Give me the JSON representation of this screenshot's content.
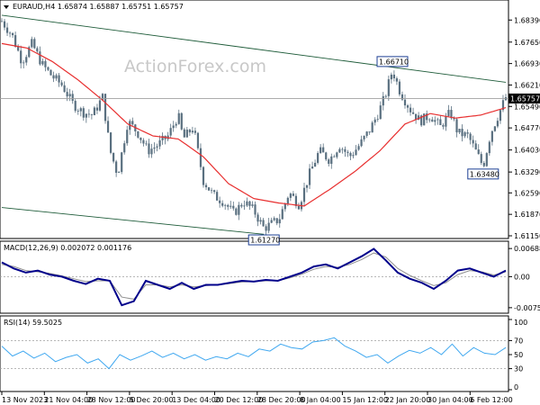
{
  "watermark": "ActionForex.com",
  "price_panel": {
    "title": "EURAUD,H4  1.65874 1.65887 1.65751 1.65757",
    "current_price_label": "1.65757"
  },
  "macd_panel": {
    "title": "MACD(12,26,9) 0.002072 0.001176"
  },
  "rsi_panel": {
    "title": "RSI(14) 59.5025"
  },
  "colors": {
    "candle": "#5a7080",
    "ma": "#e83030",
    "trendline": "#1f5c3a",
    "macd": "#00008b",
    "signal": "#909090",
    "rsi": "#40a8f0",
    "level": "#a0a0a0",
    "box": "#1c3f94",
    "grid": "#d8d8d8"
  },
  "chart_data": [
    {
      "type": "candlestick",
      "name": "EURAUD H4",
      "ylim": [
        1.6115,
        1.687
      ],
      "y_ticks": [
        "1.68390",
        "1.67650",
        "1.66930",
        "1.66210",
        "1.65490",
        "1.64770",
        "1.64030",
        "1.63290",
        "1.62590",
        "1.61870",
        "1.61150"
      ],
      "x_ticks": [
        "13 Nov 2023",
        "21 Nov 04:00",
        "28 Nov 12:00",
        "5 Dec 20:00",
        "13 Dec 04:00",
        "20 Dec 12:00",
        "28 Dec 20:00",
        "8 Jan 04:00",
        "15 Jan 12:00",
        "22 Jan 20:00",
        "30 Jan 04:00",
        "6 Feb 12:00"
      ],
      "close_path": [
        [
          0,
          1.6835
        ],
        [
          0.02,
          1.679
        ],
        [
          0.04,
          1.67
        ],
        [
          0.06,
          1.676
        ],
        [
          0.08,
          1.669
        ],
        [
          0.1,
          1.665
        ],
        [
          0.12,
          1.662
        ],
        [
          0.14,
          1.656
        ],
        [
          0.16,
          1.653
        ],
        [
          0.18,
          1.652
        ],
        [
          0.2,
          1.658
        ],
        [
          0.215,
          1.64
        ],
        [
          0.23,
          1.632
        ],
        [
          0.25,
          1.65
        ],
        [
          0.27,
          1.646
        ],
        [
          0.29,
          1.64
        ],
        [
          0.31,
          1.642
        ],
        [
          0.33,
          1.645
        ],
        [
          0.35,
          1.652
        ],
        [
          0.36,
          1.644
        ],
        [
          0.38,
          1.648
        ],
        [
          0.4,
          1.63
        ],
        [
          0.42,
          1.625
        ],
        [
          0.44,
          1.623
        ],
        [
          0.46,
          1.619
        ],
        [
          0.48,
          1.623
        ],
        [
          0.5,
          1.62
        ],
        [
          0.52,
          1.614
        ],
        [
          0.55,
          1.617
        ],
        [
          0.57,
          1.626
        ],
        [
          0.59,
          1.622
        ],
        [
          0.61,
          1.632
        ],
        [
          0.63,
          1.64
        ],
        [
          0.65,
          1.637
        ],
        [
          0.67,
          1.642
        ],
        [
          0.69,
          1.638
        ],
        [
          0.71,
          1.642
        ],
        [
          0.73,
          1.647
        ],
        [
          0.745,
          1.652
        ],
        [
          0.76,
          1.658
        ],
        [
          0.775,
          1.6671
        ],
        [
          0.79,
          1.66
        ],
        [
          0.81,
          1.654
        ],
        [
          0.83,
          1.65
        ],
        [
          0.85,
          1.652
        ],
        [
          0.87,
          1.648
        ],
        [
          0.89,
          1.653
        ],
        [
          0.905,
          1.646
        ],
        [
          0.925,
          1.645
        ],
        [
          0.94,
          1.64
        ],
        [
          0.955,
          1.6348
        ],
        [
          0.97,
          1.646
        ],
        [
          0.985,
          1.652
        ],
        [
          1.0,
          1.658
        ]
      ],
      "ma_path": [
        [
          0,
          1.676
        ],
        [
          0.05,
          1.6745
        ],
        [
          0.1,
          1.67
        ],
        [
          0.15,
          1.664
        ],
        [
          0.2,
          1.657
        ],
        [
          0.25,
          1.649
        ],
        [
          0.3,
          1.645
        ],
        [
          0.35,
          1.644
        ],
        [
          0.4,
          1.638
        ],
        [
          0.45,
          1.629
        ],
        [
          0.5,
          1.624
        ],
        [
          0.55,
          1.6225
        ],
        [
          0.6,
          1.6215
        ],
        [
          0.65,
          1.627
        ],
        [
          0.7,
          1.633
        ],
        [
          0.75,
          1.64
        ],
        [
          0.8,
          1.649
        ],
        [
          0.85,
          1.6525
        ],
        [
          0.9,
          1.651
        ],
        [
          0.95,
          1.652
        ],
        [
          1.0,
          1.6545
        ]
      ],
      "trendlines": [
        [
          [
            0,
            1.6855
          ],
          [
            1.0,
            1.663
          ]
        ],
        [
          [
            0,
            1.621
          ],
          [
            0.52,
            1.612
          ]
        ]
      ],
      "annotations": [
        {
          "label": "1.66710",
          "x": 0.775,
          "y": 1.6671
        },
        {
          "label": "1.63480",
          "x": 0.955,
          "y": 1.6348
        },
        {
          "label": "1.61270",
          "x": 0.52,
          "y": 1.6127
        }
      ]
    },
    {
      "type": "line",
      "name": "MACD(12,26,9)",
      "ylim": [
        -0.0085,
        0.0078
      ],
      "y_ticks": [
        "0.006886",
        "0.00",
        "-0.007591"
      ],
      "series": [
        {
          "name": "MACD",
          "values": [
            0.0035,
            0.002,
            0.001,
            0.0015,
            0.0005,
            0.0,
            -0.001,
            -0.0018,
            -0.0005,
            -0.001,
            -0.007,
            -0.006,
            -0.001,
            -0.002,
            -0.003,
            -0.0015,
            -0.003,
            -0.002,
            -0.002,
            -0.0015,
            -0.001,
            -0.0012,
            -0.0008,
            -0.001,
            0.0,
            0.001,
            0.0025,
            0.003,
            0.002,
            0.0035,
            0.005,
            0.0068,
            0.004,
            0.001,
            -0.0005,
            -0.0015,
            -0.003,
            -0.001,
            0.0015,
            0.002,
            0.001,
            0.0,
            0.0015
          ]
        },
        {
          "name": "Signal",
          "values": [
            0.003,
            0.0025,
            0.0015,
            0.0012,
            0.0008,
            0.0002,
            -0.0005,
            -0.0012,
            -0.001,
            -0.001,
            -0.005,
            -0.0055,
            -0.002,
            -0.002,
            -0.0025,
            -0.002,
            -0.0025,
            -0.0022,
            -0.002,
            -0.0017,
            -0.0013,
            -0.0012,
            -0.001,
            -0.001,
            -0.0003,
            0.0006,
            0.0018,
            0.0025,
            0.0023,
            0.003,
            0.0042,
            0.0058,
            0.0048,
            0.002,
            0.0003,
            -0.001,
            -0.0022,
            -0.0015,
            0.0005,
            0.0015,
            0.0012,
            0.0004,
            0.0012
          ]
        }
      ]
    },
    {
      "type": "line",
      "name": "RSI(14)",
      "ylim": [
        0,
        100
      ],
      "y_ticks": [
        "100",
        "70",
        "50",
        "30",
        "0"
      ],
      "levels": [
        70,
        30
      ],
      "series": [
        {
          "name": "RSI",
          "values": [
            62,
            48,
            55,
            45,
            52,
            40,
            46,
            50,
            38,
            44,
            30,
            50,
            42,
            48,
            55,
            46,
            52,
            44,
            50,
            42,
            47,
            44,
            52,
            47,
            58,
            55,
            65,
            60,
            58,
            68,
            70,
            74,
            62,
            55,
            46,
            50,
            38,
            48,
            56,
            52,
            60,
            50,
            65,
            48,
            60,
            52,
            50,
            60
          ]
        }
      ]
    }
  ]
}
